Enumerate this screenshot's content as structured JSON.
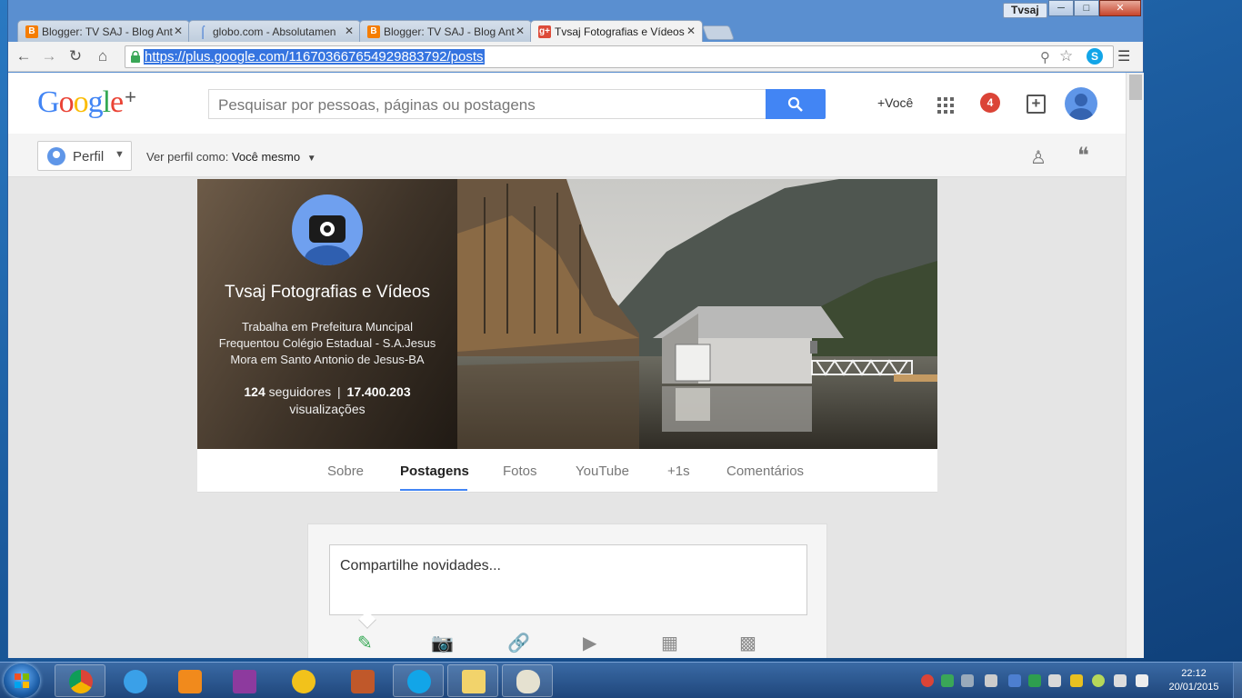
{
  "colors": {
    "accent": "#4285f4",
    "notification": "#db4437",
    "url_highlight": "#3574e0"
  },
  "window": {
    "user_badge": "Tvsaj",
    "controls": [
      "minimize-icon",
      "maximize-icon",
      "close-icon"
    ]
  },
  "browser": {
    "tabs": [
      {
        "title": "Blogger: TV SAJ - Blog Ant",
        "icon": "blogger-icon",
        "active": false
      },
      {
        "title": "globo.com - Absolutamen",
        "icon": "globo-icon",
        "active": false
      },
      {
        "title": "Blogger: TV SAJ - Blog Ant",
        "icon": "blogger-icon",
        "active": false
      },
      {
        "title": "Tvsaj Fotografias e Vídeos",
        "icon": "google-plus-icon",
        "active": true
      }
    ],
    "url": "https://plus.google.com/116703667654929883792/posts"
  },
  "gplus": {
    "logo_text": "Google+",
    "search_placeholder": "Pesquisar por pessoas, páginas ou postagens",
    "you_link": "+Você",
    "notification_count": "4",
    "profile_dropdown": "Perfil",
    "view_as_label": "Ver perfil como:",
    "view_as_value": "Você mesmo"
  },
  "profile": {
    "name": "Tvsaj Fotografias e Vídeos",
    "info": [
      "Trabalha em Prefeitura Muncipal",
      "Frequentou Colégio Estadual - S.A.Jesus",
      "Mora em Santo Antonio de Jesus-BA"
    ],
    "followers_count": "124",
    "followers_label": "seguidores",
    "separator": "|",
    "views_count": "17.400.203",
    "views_label": "visualizações",
    "tabs": [
      "Sobre",
      "Postagens",
      "Fotos",
      "YouTube",
      "+1s",
      "Comentários"
    ],
    "active_tab": "Postagens"
  },
  "share": {
    "placeholder": "Compartilhe novidades...",
    "icons": [
      "pencil-icon",
      "camera-icon",
      "link-icon",
      "video-icon",
      "event-icon",
      "poll-icon"
    ]
  },
  "taskbar": {
    "apps": [
      "chrome-icon",
      "internet-explorer-icon",
      "media-player-icon",
      "winrar-icon",
      "sunflower-icon",
      "game-icon",
      "skype-icon",
      "folder-icon",
      "paint-icon"
    ],
    "time": "22:12",
    "date": "20/01/2015"
  }
}
